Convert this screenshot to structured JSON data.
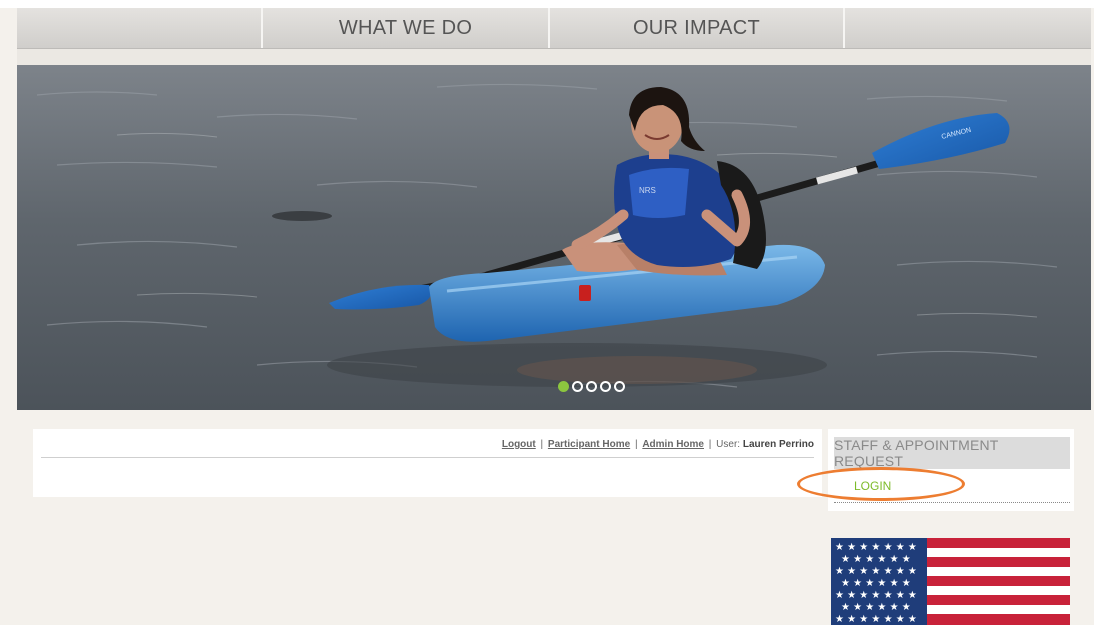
{
  "nav": {
    "items": [
      {
        "label": ""
      },
      {
        "label": "WHAT WE DO"
      },
      {
        "label": "OUR IMPACT"
      },
      {
        "label": ""
      }
    ]
  },
  "hero": {
    "paddle_brand": "CANNON",
    "vest_logo": "NRS"
  },
  "slider": {
    "dot_count": 5,
    "active_index": 0
  },
  "user_bar": {
    "logout": "Logout",
    "participant_home": "Participant Home",
    "admin_home": "Admin Home",
    "separator": "|",
    "user_label": "User:",
    "user_name": "Lauren Perrino"
  },
  "sidebar": {
    "heading": "STAFF & APPOINTMENT REQUEST",
    "login": "LOGIN"
  },
  "colors": {
    "accent_green": "#8cc63f",
    "login_green": "#7dbb2a",
    "highlight_orange": "#ed7d31"
  },
  "icons": {
    "flag": "us-flag-icon"
  }
}
